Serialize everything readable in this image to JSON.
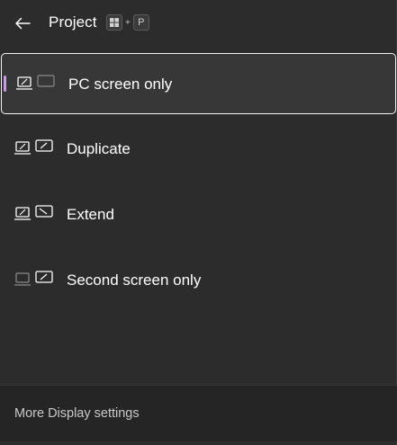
{
  "header": {
    "title": "Project",
    "shortcut": {
      "key1_icon": "windows-logo",
      "plus": "+",
      "key2": "P"
    }
  },
  "options": [
    {
      "label": "PC screen only",
      "icon": "pc-screen-only-icon",
      "selected": true
    },
    {
      "label": "Duplicate",
      "icon": "duplicate-icon",
      "selected": false
    },
    {
      "label": "Extend",
      "icon": "extend-icon",
      "selected": false
    },
    {
      "label": "Second screen only",
      "icon": "second-screen-only-icon",
      "selected": false
    }
  ],
  "footer": {
    "link": "More Display settings"
  },
  "colors": {
    "background": "#2c2c2c",
    "selected_background": "#373737",
    "selected_border": "#f4f4f4",
    "accent": "#c79be4",
    "footer_background": "#252525"
  }
}
